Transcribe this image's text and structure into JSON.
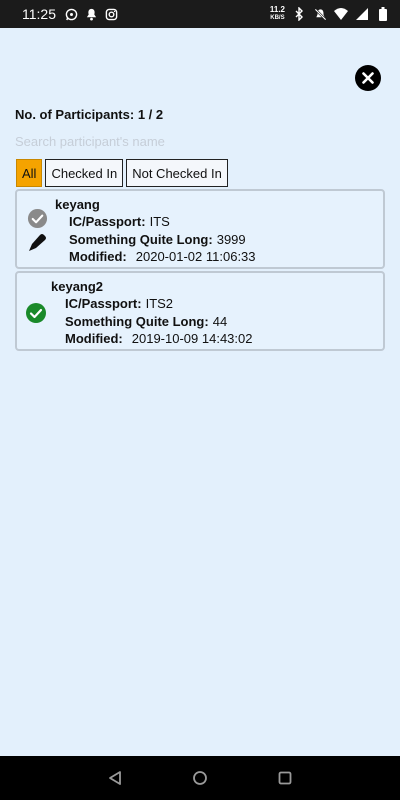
{
  "status_bar": {
    "time": "11:25",
    "speed_value": "11.2",
    "speed_unit": "KB/S",
    "left_icons": [
      "whatsapp-icon",
      "notification-icon",
      "instagram-icon"
    ],
    "right_icons": [
      "bluetooth-icon",
      "mute-icon",
      "wifi-icon",
      "signal-icon",
      "battery-icon"
    ]
  },
  "header": {
    "participants_label": "No. of Participants:",
    "participants_value": "1 / 2"
  },
  "search": {
    "placeholder": "Search participant's name",
    "value": ""
  },
  "filters": [
    {
      "label": "All",
      "active": true
    },
    {
      "label": "Checked In",
      "active": false
    },
    {
      "label": "Not Checked In",
      "active": false
    }
  ],
  "participants": [
    {
      "name": "keyang",
      "checked_in": false,
      "bookmarked": true,
      "fields": [
        {
          "label": "IC/Passport:",
          "value": "ITS"
        },
        {
          "label": "Something Quite Long:",
          "value": "3999"
        },
        {
          "label": "Modified:",
          "value": "2020-01-02 11:06:33"
        }
      ]
    },
    {
      "name": "keyang2",
      "checked_in": true,
      "bookmarked": false,
      "fields": [
        {
          "label": "IC/Passport:",
          "value": "ITS2"
        },
        {
          "label": "Something Quite Long:",
          "value": "44"
        },
        {
          "label": "Modified:",
          "value": "2019-10-09 14:43:02"
        }
      ]
    }
  ],
  "colors": {
    "background": "#e3f0fc",
    "active_filter": "#f5a300",
    "checked_in": "#1a8a2a",
    "not_checked": "#8a8a8a"
  }
}
